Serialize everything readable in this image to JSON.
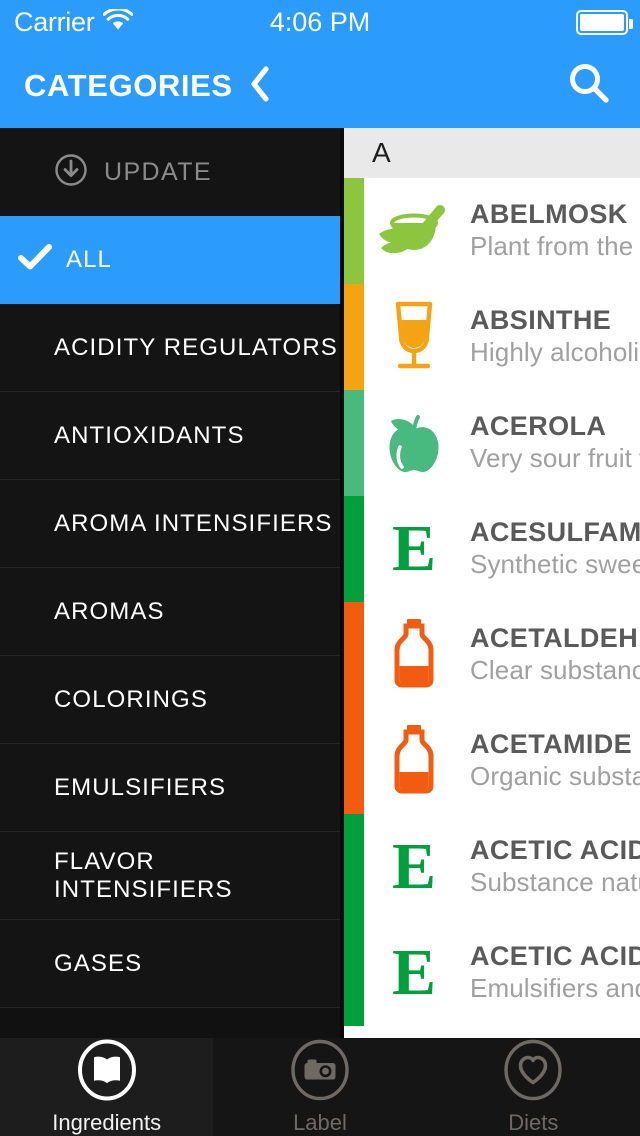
{
  "status_bar": {
    "carrier": "Carrier",
    "time": "4:06 PM",
    "wifi_icon": "wifi-icon",
    "battery_icon": "battery-icon"
  },
  "nav_bar": {
    "title": "CATEGORIES",
    "back_icon": "chevron-left-icon",
    "search_icon": "search-icon",
    "background": "#2b9bfc"
  },
  "drawer": {
    "update": {
      "label": "UPDATE",
      "icon": "download-circle-icon"
    },
    "items": [
      {
        "label": "ALL",
        "selected": true,
        "check_icon": "checkmark-icon"
      },
      {
        "label": "ACIDITY REGULATORS",
        "selected": false
      },
      {
        "label": "ANTIOXIDANTS",
        "selected": false
      },
      {
        "label": "AROMA INTENSIFIERS",
        "selected": false
      },
      {
        "label": "AROMAS",
        "selected": false
      },
      {
        "label": "COLORINGS",
        "selected": false
      },
      {
        "label": "EMULSIFIERS",
        "selected": false
      },
      {
        "label": "FLAVOR INTENSIFIERS",
        "selected": false
      },
      {
        "label": "GASES",
        "selected": false
      }
    ]
  },
  "content": {
    "section_header": "A",
    "rows": [
      {
        "title": "ABELMOSK",
        "subtitle": "Plant from the",
        "icon": "mortar-pestle-icon",
        "color": "#8cc63e"
      },
      {
        "title": "ABSINTHE",
        "subtitle": "Highly alcoholic",
        "icon": "cocktail-glass-icon",
        "color": "#f5a213"
      },
      {
        "title": "ACEROLA",
        "subtitle": "Very sour fruit w",
        "icon": "apple-icon",
        "color": "#48b97f"
      },
      {
        "title": "ACESULFAM",
        "subtitle": "Synthetic swee",
        "icon": "e-number-icon",
        "color": "#00a03c"
      },
      {
        "title": "ACETALDEH",
        "subtitle": "Clear substanc",
        "icon": "bottle-icon",
        "color": "#f25c11"
      },
      {
        "title": "ACETAMIDE",
        "subtitle": "Organic substa",
        "icon": "bottle-icon",
        "color": "#f25c11"
      },
      {
        "title": "ACETIC ACID",
        "subtitle": "Substance natu",
        "icon": "e-number-icon",
        "color": "#00a03c"
      },
      {
        "title": "ACETIC ACID",
        "subtitle": "Emulsifiers and",
        "icon": "e-number-icon",
        "color": "#00a03c"
      }
    ]
  },
  "tab_bar": {
    "tabs": [
      {
        "label": "Ingredients",
        "icon": "book-icon",
        "active": true
      },
      {
        "label": "Label",
        "icon": "camera-icon",
        "active": false
      },
      {
        "label": "Diets",
        "icon": "heart-icon",
        "active": false
      }
    ]
  }
}
